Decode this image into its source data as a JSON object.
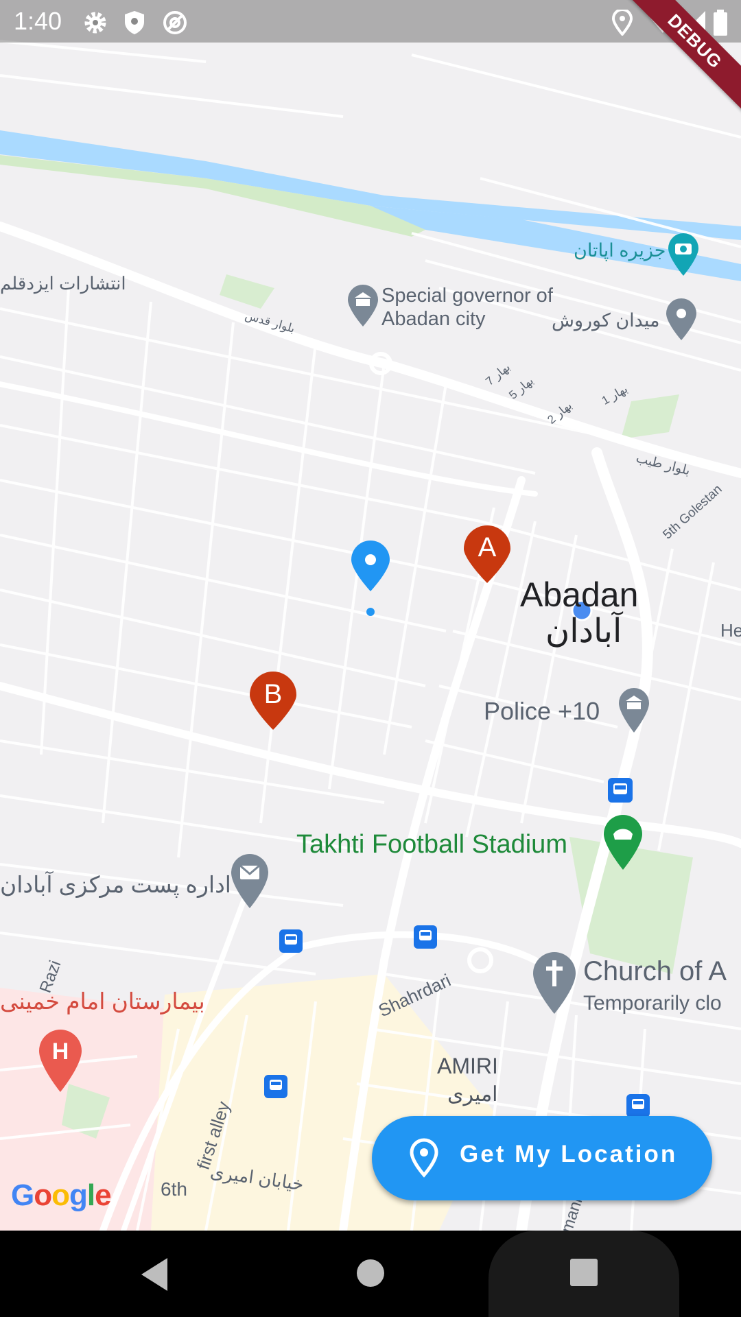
{
  "status_bar": {
    "time": "1:40",
    "left_icons": [
      "settings-icon",
      "shield-icon",
      "at-sign-icon"
    ],
    "right_icons": [
      "location-icon",
      "wifi-icon",
      "signal-icon",
      "battery-icon"
    ],
    "debug_banner": "DEBUG"
  },
  "map": {
    "city": {
      "name_en": "Abadan",
      "name_fa": "آبادان"
    },
    "places": {
      "island": "جزیره اپاتان",
      "publisher": "انتشارات ایزدقلم",
      "governor": "Special governor of Abadan city",
      "square": "میدان کوروش",
      "police": "Police +10",
      "stadium": "Takhti Football Stadium",
      "post_office": "اداره پست مرکزی آبادان",
      "hospital": "بیمارستان امام خمینی",
      "church": "Church of A",
      "church_status": "Temporarily clo",
      "district_en": "AMIRI",
      "district_fa": "امیری"
    },
    "streets": {
      "quds_blvd": "بلوار قدس",
      "bahar7": "بهار 7",
      "bahar5": "بهار 5",
      "bahar2": "بهار 2",
      "bahar1": "بهار 1",
      "tayyeb_blvd": "بلوار طیب",
      "golestan": "5th Golestan",
      "razi": "Razi",
      "shahrdari": "Shahrdari",
      "first_alley": "first alley",
      "sixth": "6th",
      "amiri_st": "خیابان امیری",
      "he": "He",
      "mani": "mani"
    },
    "markers": [
      {
        "label": "A",
        "color": "#c8380f"
      },
      {
        "label": "B",
        "color": "#c8380f"
      }
    ],
    "current_location_pin_color": "#2196f3",
    "attribution": "Google"
  },
  "get_location_button": {
    "label": "Get My Location",
    "icon": "location-pin-icon",
    "color": "#2196f3"
  },
  "nav_bar": {
    "buttons": [
      "back-icon",
      "home-icon",
      "recents-icon"
    ]
  }
}
